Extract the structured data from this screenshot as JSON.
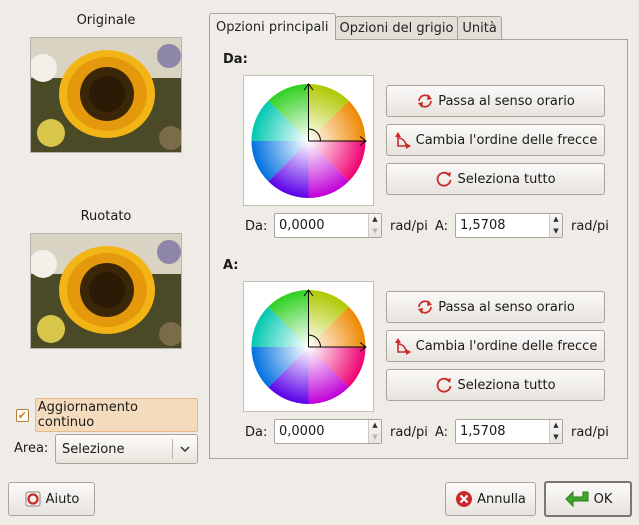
{
  "left": {
    "original_caption": "Originale",
    "rotated_caption": "Ruotato",
    "continuous_update_label": "Aggiornamento continuo",
    "continuous_update_checked": true,
    "area_label": "Area:",
    "area_value": "Selezione"
  },
  "tabs": [
    "Opzioni principali",
    "Opzioni del grigio",
    "Unità"
  ],
  "active_tab": 0,
  "from_section": {
    "title": "Da:",
    "btn_clockwise": "Passa al senso orario",
    "btn_swap": "Cambia l'ordine delle frecce",
    "btn_select_all": "Seleziona tutto",
    "from_label": "Da:",
    "from_value": "0,0000",
    "from_unit": "rad/pi",
    "to_label": "A:",
    "to_value": "1,5708",
    "to_unit": "rad/pi"
  },
  "to_section": {
    "title": "A:",
    "btn_clockwise": "Passa al senso orario",
    "btn_swap": "Cambia l'ordine delle frecce",
    "btn_select_all": "Seleziona tutto",
    "from_label": "Da:",
    "from_value": "0,0000",
    "from_unit": "rad/pi",
    "to_label": "A:",
    "to_value": "1,5708",
    "to_unit": "rad/pi"
  },
  "footer": {
    "help_label": "Aiuto",
    "cancel_label": "Annulla",
    "ok_label": "OK"
  },
  "colors": {
    "ok_icon": "#3fa82b",
    "cancel_icon": "#cc2a2a",
    "rotate_icon": "#cc2a2a",
    "checkbox_highlight": "#f4dbbd"
  }
}
